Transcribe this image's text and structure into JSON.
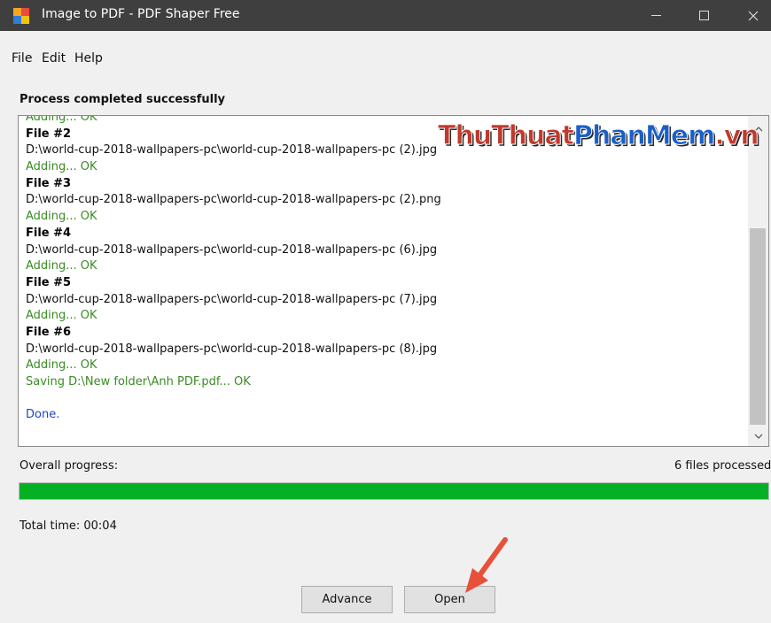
{
  "window": {
    "title": "Image to PDF - PDF Shaper Free",
    "controls": {
      "minimize": "minimize-icon",
      "maximize": "maximize-icon",
      "close": "close-icon"
    }
  },
  "menu": {
    "file": "File",
    "edit": "Edit",
    "help": "Help"
  },
  "status": {
    "heading": "Process completed successfully"
  },
  "log": [
    {
      "text": "Adding... OK",
      "style": "green"
    },
    {
      "text": "File #2",
      "style": "bold"
    },
    {
      "text": "D:\\world-cup-2018-wallpapers-pc\\world-cup-2018-wallpapers-pc (2).jpg",
      "style": "black"
    },
    {
      "text": "Adding... OK",
      "style": "green"
    },
    {
      "text": "File #3",
      "style": "bold"
    },
    {
      "text": "D:\\world-cup-2018-wallpapers-pc\\world-cup-2018-wallpapers-pc (2).png",
      "style": "black"
    },
    {
      "text": "Adding... OK",
      "style": "green"
    },
    {
      "text": "File #4",
      "style": "bold"
    },
    {
      "text": "D:\\world-cup-2018-wallpapers-pc\\world-cup-2018-wallpapers-pc (6).jpg",
      "style": "black"
    },
    {
      "text": "Adding... OK",
      "style": "green"
    },
    {
      "text": "File #5",
      "style": "bold"
    },
    {
      "text": "D:\\world-cup-2018-wallpapers-pc\\world-cup-2018-wallpapers-pc (7).jpg",
      "style": "black"
    },
    {
      "text": "Adding... OK",
      "style": "green"
    },
    {
      "text": "File #6",
      "style": "bold"
    },
    {
      "text": "D:\\world-cup-2018-wallpapers-pc\\world-cup-2018-wallpapers-pc (8).jpg",
      "style": "black"
    },
    {
      "text": "Adding... OK",
      "style": "green"
    },
    {
      "text": "Saving D:\\New folder\\Anh PDF.pdf... OK",
      "style": "green"
    },
    {
      "text": "",
      "style": "black"
    },
    {
      "text": "Done.",
      "style": "blue"
    }
  ],
  "watermark": {
    "part1": "ThuThuat",
    "part2": "PhanMem",
    "part3": ".vn"
  },
  "progress": {
    "label": "Overall progress:",
    "files_processed": "6 files processed",
    "fraction": 1.0,
    "color": "#06b025"
  },
  "total_time": "Total time: 00:04",
  "buttons": {
    "advance": "Advance",
    "open": "Open"
  },
  "colors": {
    "titlebar": "#3f3f3f",
    "log_ok": "#3a8b24",
    "log_done": "#2244cc",
    "annotation_arrow": "#e8503a"
  }
}
